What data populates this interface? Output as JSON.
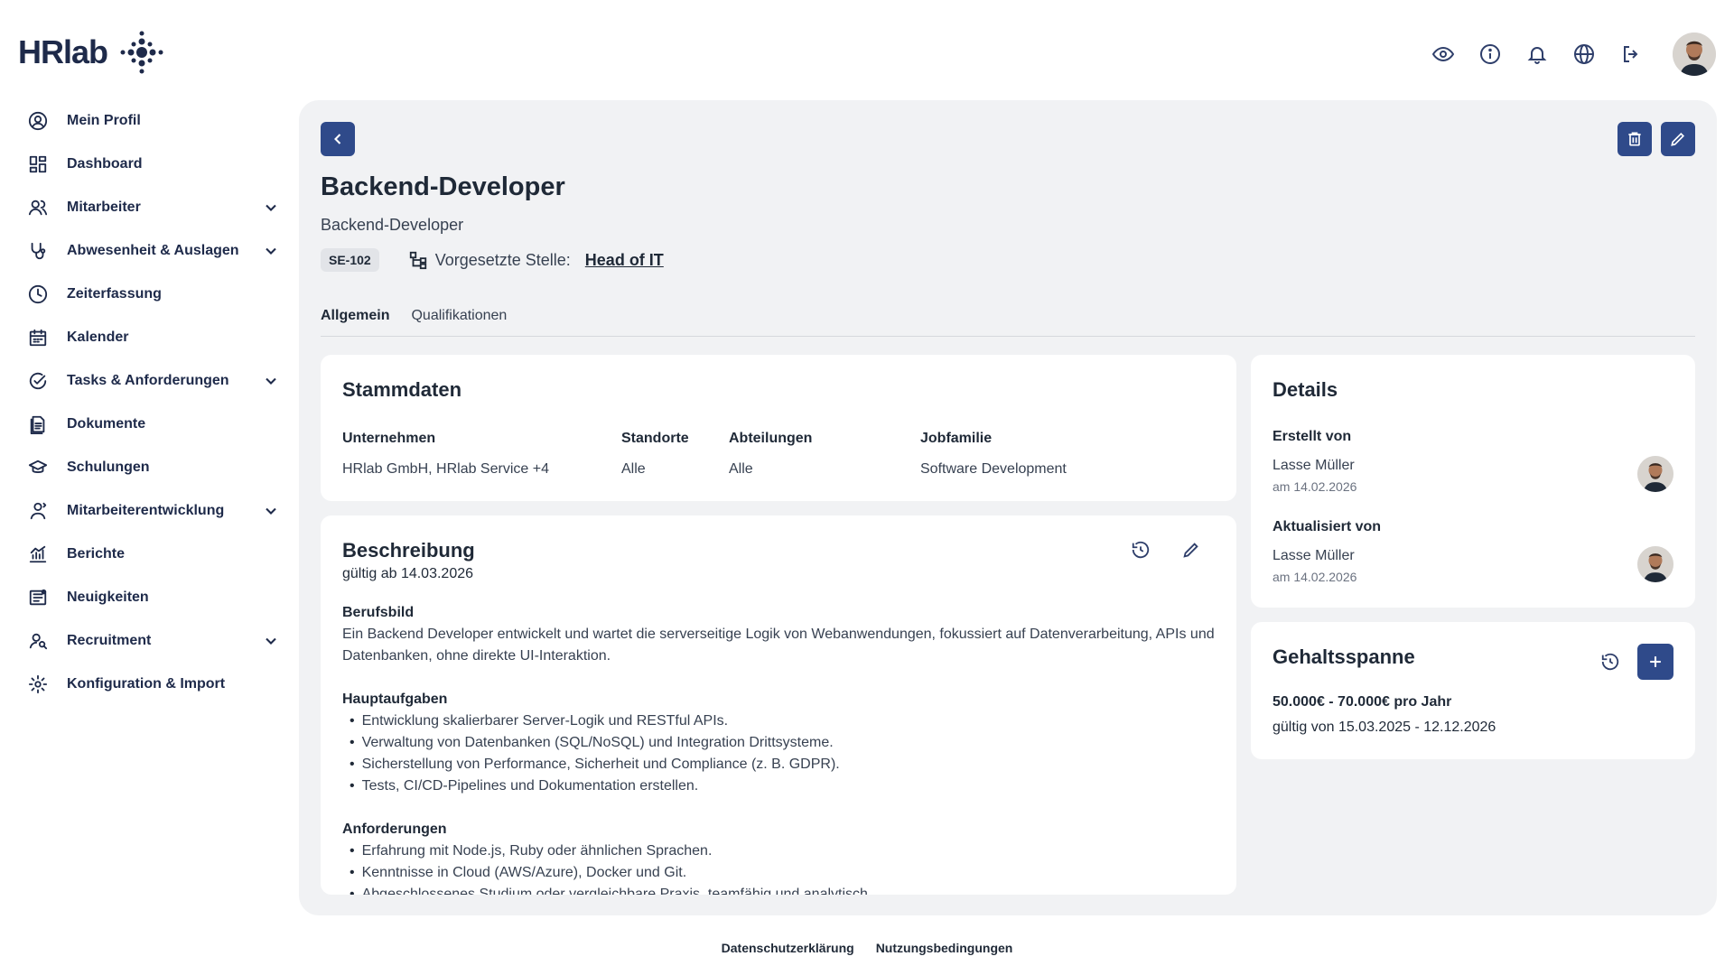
{
  "brand": {
    "logo_text": "HRlab"
  },
  "topbar": {
    "icons": [
      "eye-icon",
      "info-icon",
      "bell-icon",
      "globe-icon",
      "logout-icon"
    ]
  },
  "sidebar": {
    "items": [
      {
        "label": "Mein Profil",
        "icon": "user-circle-icon",
        "expandable": false
      },
      {
        "label": "Dashboard",
        "icon": "dashboard-icon",
        "expandable": false
      },
      {
        "label": "Mitarbeiter",
        "icon": "users-icon",
        "expandable": true
      },
      {
        "label": "Abwesenheit & Auslagen",
        "icon": "stethoscope-icon",
        "expandable": true
      },
      {
        "label": "Zeiterfassung",
        "icon": "clock-icon",
        "expandable": false
      },
      {
        "label": "Kalender",
        "icon": "calendar-icon",
        "expandable": false
      },
      {
        "label": "Tasks & Anforderungen",
        "icon": "check-circle-icon",
        "expandable": true
      },
      {
        "label": "Dokumente",
        "icon": "document-icon",
        "expandable": false
      },
      {
        "label": "Schulungen",
        "icon": "graduation-cap-icon",
        "expandable": false
      },
      {
        "label": "Mitarbeiterentwicklung",
        "icon": "user-growth-icon",
        "expandable": true
      },
      {
        "label": "Berichte",
        "icon": "chart-icon",
        "expandable": false
      },
      {
        "label": "Neuigkeiten",
        "icon": "news-icon",
        "expandable": false
      },
      {
        "label": "Recruitment",
        "icon": "user-search-icon",
        "expandable": true
      },
      {
        "label": "Konfiguration & Import",
        "icon": "gear-icon",
        "expandable": false
      }
    ]
  },
  "page": {
    "title": "Backend-Developer",
    "subtitle": "Backend-Developer",
    "code": "SE-102",
    "supervisor_label": "Vorgesetzte Stelle:",
    "supervisor_value": "Head of IT",
    "tabs": [
      "Allgemein",
      "Qualifikationen"
    ],
    "active_tab": "Allgemein"
  },
  "stammdaten": {
    "title": "Stammdaten",
    "columns": [
      {
        "header": "Unternehmen",
        "value": "HRlab GmbH, HRlab Service +4"
      },
      {
        "header": "Standorte",
        "value": "Alle"
      },
      {
        "header": "Abteilungen",
        "value": "Alle"
      },
      {
        "header": "Jobfamilie",
        "value": "Software Development"
      }
    ]
  },
  "beschreibung": {
    "title": "Beschreibung",
    "valid_from": "gültig ab 14.03.2026",
    "berufsbild_title": "Berufsbild",
    "berufsbild_text": "Ein Backend Developer entwickelt und wartet die serverseitige Logik von Webanwendungen, fokussiert auf Datenverarbeitung, APIs und Datenbanken, ohne direkte UI-Interaktion.",
    "hauptaufgaben_title": "Hauptaufgaben",
    "hauptaufgaben": [
      "Entwicklung skalierbarer Server-Logik und RESTful APIs.",
      "Verwaltung von Datenbanken (SQL/NoSQL) und Integration Drittsysteme.",
      "Sicherstellung von Performance, Sicherheit und Compliance (z. B. GDPR).",
      "Tests, CI/CD-Pipelines und Dokumentation erstellen."
    ],
    "anforderungen_title": "Anforderungen",
    "anforderungen": [
      "Erfahrung mit Node.js, Ruby oder ähnlichen Sprachen.",
      "Kenntnisse in Cloud (AWS/Azure), Docker und Git.",
      "Abgeschlossenes Studium oder vergleichbare Praxis, teamfähig und analytisch."
    ]
  },
  "details": {
    "title": "Details",
    "created_label": "Erstellt von",
    "created_name": "Lasse Müller",
    "created_date": "am 14.02.2026",
    "updated_label": "Aktualisiert von",
    "updated_name": "Lasse Müller",
    "updated_date": "am 14.02.2026"
  },
  "gehalt": {
    "title": "Gehaltsspanne",
    "range": "50.000€ - 70.000€ pro Jahr",
    "validity": "gültig von 15.03.2025 - 12.12.2026"
  },
  "footer": {
    "privacy": "Datenschutzerklärung",
    "terms": "Nutzungsbedingungen"
  },
  "colors": {
    "primary": "#2f4a8a",
    "panel": "#f1f2f4",
    "text": "#1f2937"
  }
}
